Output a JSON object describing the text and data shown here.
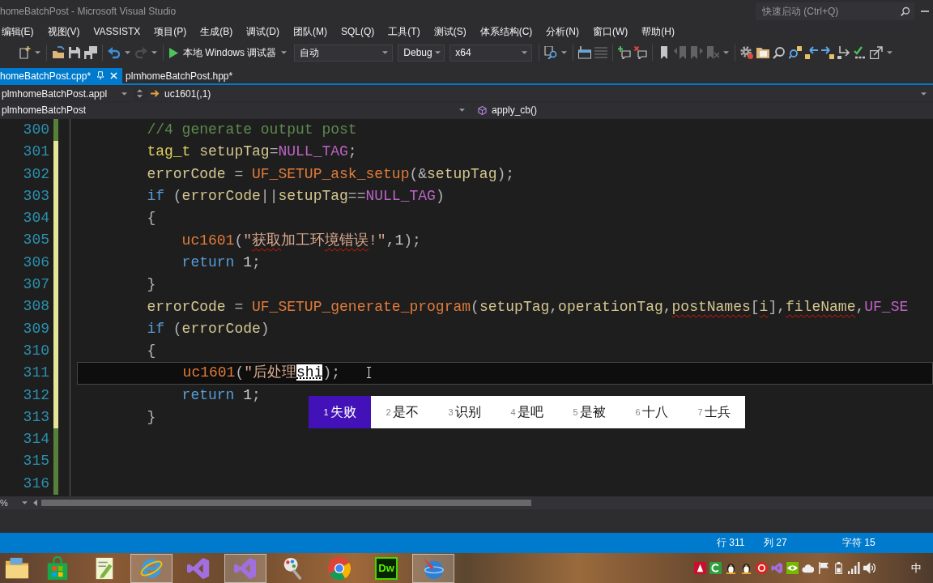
{
  "window": {
    "title": "homeBatchPost - Microsoft Visual Studio",
    "quick_launch": {
      "placeholder": "快速启动 (Ctrl+Q)"
    }
  },
  "menu": [
    "编辑(E)",
    "视图(V)",
    "VASSISTX",
    "项目(P)",
    "生成(B)",
    "调试(D)",
    "团队(M)",
    "SQL(Q)",
    "工具(T)",
    "测试(S)",
    "体系结构(C)",
    "分析(N)",
    "窗口(W)",
    "帮助(H)"
  ],
  "toolbar": {
    "left_buttons": [
      {
        "disabled": false
      },
      {
        "disabled": false
      },
      {
        "disabled": false
      },
      {
        "disabled": false
      },
      {
        "disabled": false
      },
      {
        "disabled": true
      }
    ],
    "start": {
      "label": "本地 Windows 调试器"
    },
    "dropdowns": [
      {
        "value": "自动"
      },
      {
        "value": "Debug"
      },
      {
        "value": "x64"
      }
    ],
    "right_buttons": [
      {
        "disabled": false
      },
      {
        "disabled": false
      },
      {
        "disabled": true
      },
      {
        "disabled": false
      },
      {
        "disabled": false
      },
      {
        "disabled": false
      },
      {
        "disabled": true
      },
      {
        "disabled": true
      },
      {
        "disabled": true
      },
      {
        "disabled": false
      },
      {
        "disabled": false
      },
      {
        "disabled": false
      },
      {
        "disabled": false
      },
      {
        "disabled": false
      },
      {
        "disabled": false
      },
      {
        "disabled": false
      },
      {
        "disabled": false
      },
      {
        "disabled": false
      }
    ]
  },
  "tabs": [
    {
      "label": "homeBatchPost.cpp*",
      "selected": true
    },
    {
      "label": "plmhomeBatchPost.hpp*",
      "selected": false
    }
  ],
  "navigation": {
    "project": "plmhomeBatchPost.appl",
    "member": "uc1601(,1)",
    "scope": "plmhomeBatchPost",
    "function": "apply_cb()"
  },
  "editor": {
    "lines": [
      {
        "number": "300",
        "color": "#57803a",
        "current": false,
        "tokens": [
          {
            "text": "//4 generate output post",
            "kind": "comment",
            "error": false
          }
        ]
      },
      {
        "number": "301",
        "color": "#e6e69a",
        "current": false,
        "tokens": [
          {
            "text": "tag_t",
            "kind": "type",
            "error": false
          },
          {
            "text": " setupTag",
            "kind": "ident",
            "error": false
          },
          {
            "text": "=",
            "kind": "punct",
            "error": false
          },
          {
            "text": "NULL_TAG",
            "kind": "macro",
            "error": false
          },
          {
            "text": ";",
            "kind": "punct",
            "error": false
          }
        ]
      },
      {
        "number": "302",
        "color": "#e6e69a",
        "current": false,
        "tokens": [
          {
            "text": "errorCode",
            "kind": "ident",
            "error": false
          },
          {
            "text": " = ",
            "kind": "punct",
            "error": false
          },
          {
            "text": "UF_SETUP_ask_setup",
            "kind": "func",
            "error": false
          },
          {
            "text": "(&",
            "kind": "punct",
            "error": false
          },
          {
            "text": "setupTag",
            "kind": "ident",
            "error": false
          },
          {
            "text": ");",
            "kind": "punct",
            "error": false
          }
        ]
      },
      {
        "number": "303",
        "color": "#e6e69a",
        "current": false,
        "tokens": [
          {
            "text": "if",
            "kind": "keyword",
            "error": false
          },
          {
            "text": " (",
            "kind": "punct",
            "error": false
          },
          {
            "text": "errorCode",
            "kind": "ident",
            "error": false
          },
          {
            "text": "||",
            "kind": "punct",
            "error": false
          },
          {
            "text": "setupTag",
            "kind": "ident",
            "error": false
          },
          {
            "text": "==",
            "kind": "punct",
            "error": false
          },
          {
            "text": "NULL_TAG",
            "kind": "macro",
            "error": false
          },
          {
            "text": ")",
            "kind": "punct",
            "error": false
          }
        ]
      },
      {
        "number": "304",
        "color": "#e6e69a",
        "current": false,
        "tokens": [
          {
            "text": "{",
            "kind": "punct",
            "error": false
          }
        ],
        "children": [
          {
            "number": "305",
            "color": "#e6e69a",
            "current": false,
            "tokens": [
              {
                "text": "uc1601",
                "kind": "func",
                "error": false
              },
              {
                "text": "(",
                "kind": "punct",
                "error": false
              },
              {
                "text": "\"",
                "kind": "string",
                "error": false
              },
              {
                "text": "获取",
                "kind": "string",
                "error": true
              },
              {
                "text": "加工环",
                "kind": "string",
                "error": false
              },
              {
                "text": "境错误",
                "kind": "string",
                "error": true
              },
              {
                "text": "!\"",
                "kind": "string",
                "error": false
              },
              {
                "text": ",",
                "kind": "punct",
                "error": false
              },
              {
                "text": "1",
                "kind": "number",
                "error": false
              },
              {
                "text": ");",
                "kind": "punct",
                "error": false
              }
            ]
          },
          {
            "number": "306",
            "color": "#e6e69a",
            "current": false,
            "tokens": [
              {
                "text": "return",
                "kind": "keyword",
                "error": false
              },
              {
                "text": " 1",
                "kind": "number",
                "error": false
              },
              {
                "text": ";",
                "kind": "punct",
                "error": false
              }
            ]
          }
        ]
      },
      {
        "number": "307",
        "color": "#e6e69a",
        "current": false,
        "tokens": [
          {
            "text": "}",
            "kind": "punct",
            "error": false
          }
        ]
      },
      {
        "number": "308",
        "color": "#e6e69a",
        "current": false,
        "tokens": [
          {
            "text": "errorCode",
            "kind": "ident",
            "error": false
          },
          {
            "text": " = ",
            "kind": "punct",
            "error": false
          },
          {
            "text": "UF_SETUP_generate_program",
            "kind": "func",
            "error": false
          },
          {
            "text": "(",
            "kind": "punct",
            "error": false
          },
          {
            "text": "setupTag",
            "kind": "ident",
            "error": false
          },
          {
            "text": ",",
            "kind": "punct",
            "error": false
          },
          {
            "text": "operationTag",
            "kind": "ident",
            "error": false
          },
          {
            "text": ",",
            "kind": "punct",
            "error": false
          },
          {
            "text": "postNames",
            "kind": "ident",
            "error": true
          },
          {
            "text": "[",
            "kind": "punct",
            "error": false
          },
          {
            "text": "i",
            "kind": "ident",
            "error": true
          },
          {
            "text": "]",
            "kind": "punct",
            "error": false
          },
          {
            "text": ",",
            "kind": "punct",
            "error": false
          },
          {
            "text": "fileName",
            "kind": "ident",
            "error": true
          },
          {
            "text": ",",
            "kind": "punct",
            "error": false
          },
          {
            "text": "UF_SE",
            "kind": "macro",
            "error": false
          }
        ]
      },
      {
        "number": "309",
        "color": "#e6e69a",
        "current": false,
        "tokens": [
          {
            "text": "if",
            "kind": "keyword",
            "error": false
          },
          {
            "text": " (",
            "kind": "punct",
            "error": false
          },
          {
            "text": "errorCode",
            "kind": "ident",
            "error": false
          },
          {
            "text": ")",
            "kind": "punct",
            "error": false
          }
        ]
      },
      {
        "number": "310",
        "color": "#e6e69a",
        "current": false,
        "tokens": [
          {
            "text": "{",
            "kind": "punct",
            "error": false
          }
        ],
        "children": [
          {
            "number": "311",
            "color": "#e6e69a",
            "current": true,
            "tokens": [
              {
                "text": "uc1601",
                "kind": "func",
                "error": false
              },
              {
                "text": "(",
                "kind": "punct",
                "error": false
              },
              {
                "text": "\"后处理",
                "kind": "string",
                "error": false
              },
              {
                "text": "shi",
                "kind": "composition",
                "error": false
              },
              {
                "text": ");",
                "kind": "punct",
                "error": false
              }
            ]
          },
          {
            "number": "312",
            "color": "#e6e69a",
            "current": false,
            "tokens": [
              {
                "text": "return",
                "kind": "keyword",
                "error": false
              },
              {
                "text": " 1",
                "kind": "number",
                "error": false
              },
              {
                "text": ";",
                "kind": "punct",
                "error": false
              }
            ]
          }
        ]
      },
      {
        "number": "313",
        "color": "#e6e69a",
        "current": false,
        "tokens": [
          {
            "text": "}",
            "kind": "punct",
            "error": false
          }
        ]
      },
      {
        "number": "314",
        "color": "#57803a",
        "current": false
      },
      {
        "number": "315",
        "color": "#57803a",
        "current": false
      },
      {
        "number": "316",
        "color": "#57803a",
        "current": false
      }
    ]
  },
  "ime": {
    "candidates": [
      {
        "number": "1",
        "text": "失败",
        "selected": true
      },
      {
        "number": "2",
        "text": "是不",
        "selected": false
      },
      {
        "number": "3",
        "text": "识别",
        "selected": false
      },
      {
        "number": "4",
        "text": "是吧",
        "selected": false
      },
      {
        "number": "5",
        "text": "是被",
        "selected": false
      },
      {
        "number": "6",
        "text": "十八",
        "selected": false
      },
      {
        "number": "7",
        "text": "士兵",
        "selected": false
      }
    ]
  },
  "scroll": {
    "zoom": "%"
  },
  "status_bar": {
    "line": "行 311",
    "column": "列 27",
    "character": "字符 15"
  },
  "taskbar": {
    "apps": [
      {
        "open": false
      },
      {
        "open": false
      },
      {
        "open": false
      },
      {
        "open": true
      },
      {
        "open": false
      },
      {
        "open": true
      },
      {
        "open": false
      },
      {
        "open": false
      },
      {
        "open": false,
        "label": "Dw"
      },
      {
        "open": true
      }
    ],
    "ime_indicator": "中"
  }
}
